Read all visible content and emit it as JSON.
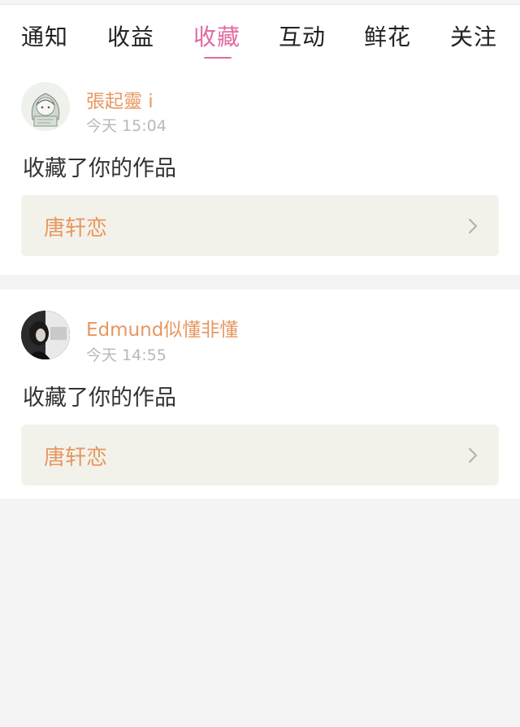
{
  "tabs": [
    "通知",
    "收益",
    "收藏",
    "互动",
    "鲜花",
    "关注"
  ],
  "active_tab": "收藏",
  "colors": {
    "accent": "#e26aa1",
    "name": "#e79760",
    "box": "#f3f2ea"
  },
  "items": [
    {
      "username": "張起靈 i",
      "time": "今天 15:04",
      "action": "收藏了你的作品",
      "work_title": "唐轩恋",
      "avatar_icon": "anime-girl-avatar"
    },
    {
      "username": "Edmund似懂非懂",
      "time": "今天 14:55",
      "action": "收藏了你的作品",
      "work_title": "唐轩恋",
      "avatar_icon": "photo-avatar"
    }
  ]
}
